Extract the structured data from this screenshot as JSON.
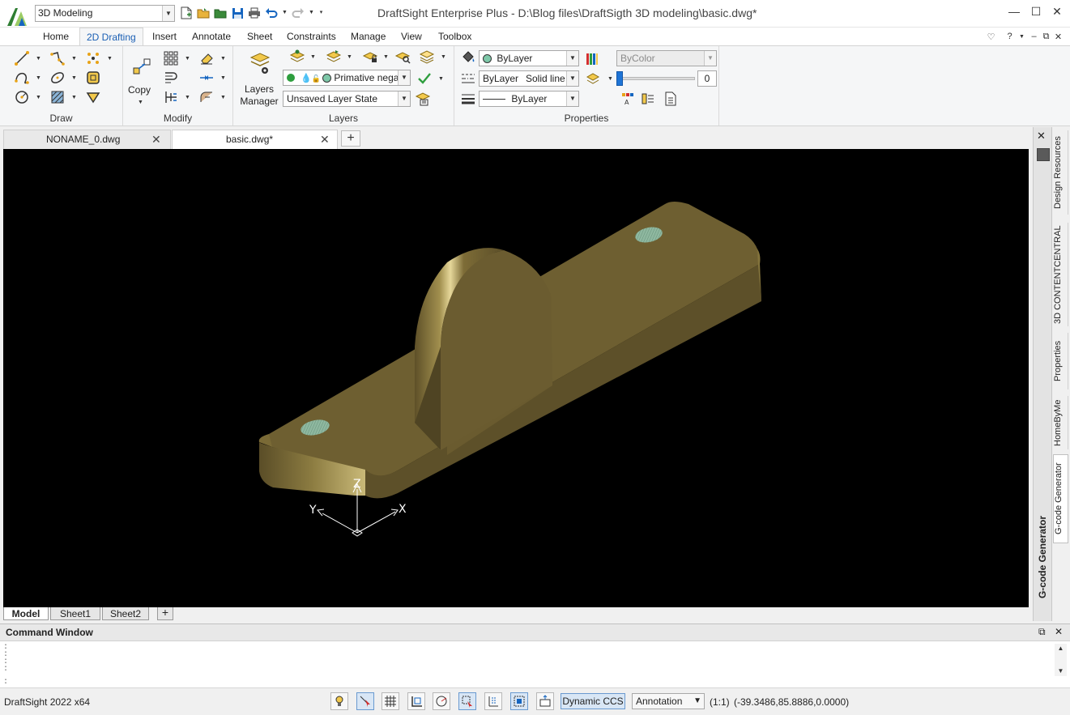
{
  "app": {
    "window_title": "DraftSight Enterprise Plus - D:\\Blog files\\DraftSigth 3D modeling\\basic.dwg*",
    "workspace": "3D Modeling",
    "version": "DraftSight 2022 x64"
  },
  "menu_tabs": [
    "Home",
    "2D Drafting",
    "Insert",
    "Annotate",
    "Sheet",
    "Constraints",
    "Manage",
    "View",
    "Toolbox"
  ],
  "active_menu_tab": "2D Drafting",
  "ribbon": {
    "panels": {
      "draw": "Draw",
      "modify": "Modify",
      "layers": "Layers",
      "properties": "Properties"
    },
    "copy_label": "Copy",
    "layers_manager_label_1": "Layers",
    "layers_manager_label_2": "Manager",
    "layer_combo": "Primative nega",
    "layer_state": "Unsaved Layer State",
    "color_combo": "ByLayer",
    "linetype_combo_left": "ByLayer",
    "linetype_combo_right": "Solid line",
    "lineweight_combo": "ByLayer",
    "plot_style_combo": "ByColor",
    "transparency_value": "0",
    "transparency_level": 0
  },
  "doc_tabs": [
    {
      "label": "NONAME_0.dwg"
    },
    {
      "label": "basic.dwg*"
    }
  ],
  "layout_tabs": [
    "Model",
    "Sheet1",
    "Sheet2"
  ],
  "viewport": {
    "axis_labels": {
      "x": "X",
      "y": "Y",
      "z": "Z"
    },
    "colors": {
      "background": "#000000",
      "model_face_top": "#6e5f31",
      "model_face_front": "#5d5029",
      "model_face_side": "#4f4423",
      "hole": "#8fb8a0"
    }
  },
  "side_palette": {
    "strip_label": "G-code Generator",
    "tabs": [
      "Design Resources",
      "3D CONTENTCENTRAL",
      "Properties",
      "HomeByMe",
      "G-code Generator"
    ]
  },
  "command_window": {
    "title": "Command Window",
    "lines": [
      ":",
      ":",
      ":",
      ":"
    ],
    "prompt": ":"
  },
  "status_bar": {
    "dynamic_ccs": "Dynamic CCS",
    "annotation": "Annotation",
    "scale": "(1:1)",
    "coordinates": "(-39.3486,85.8886,0.0000)"
  }
}
